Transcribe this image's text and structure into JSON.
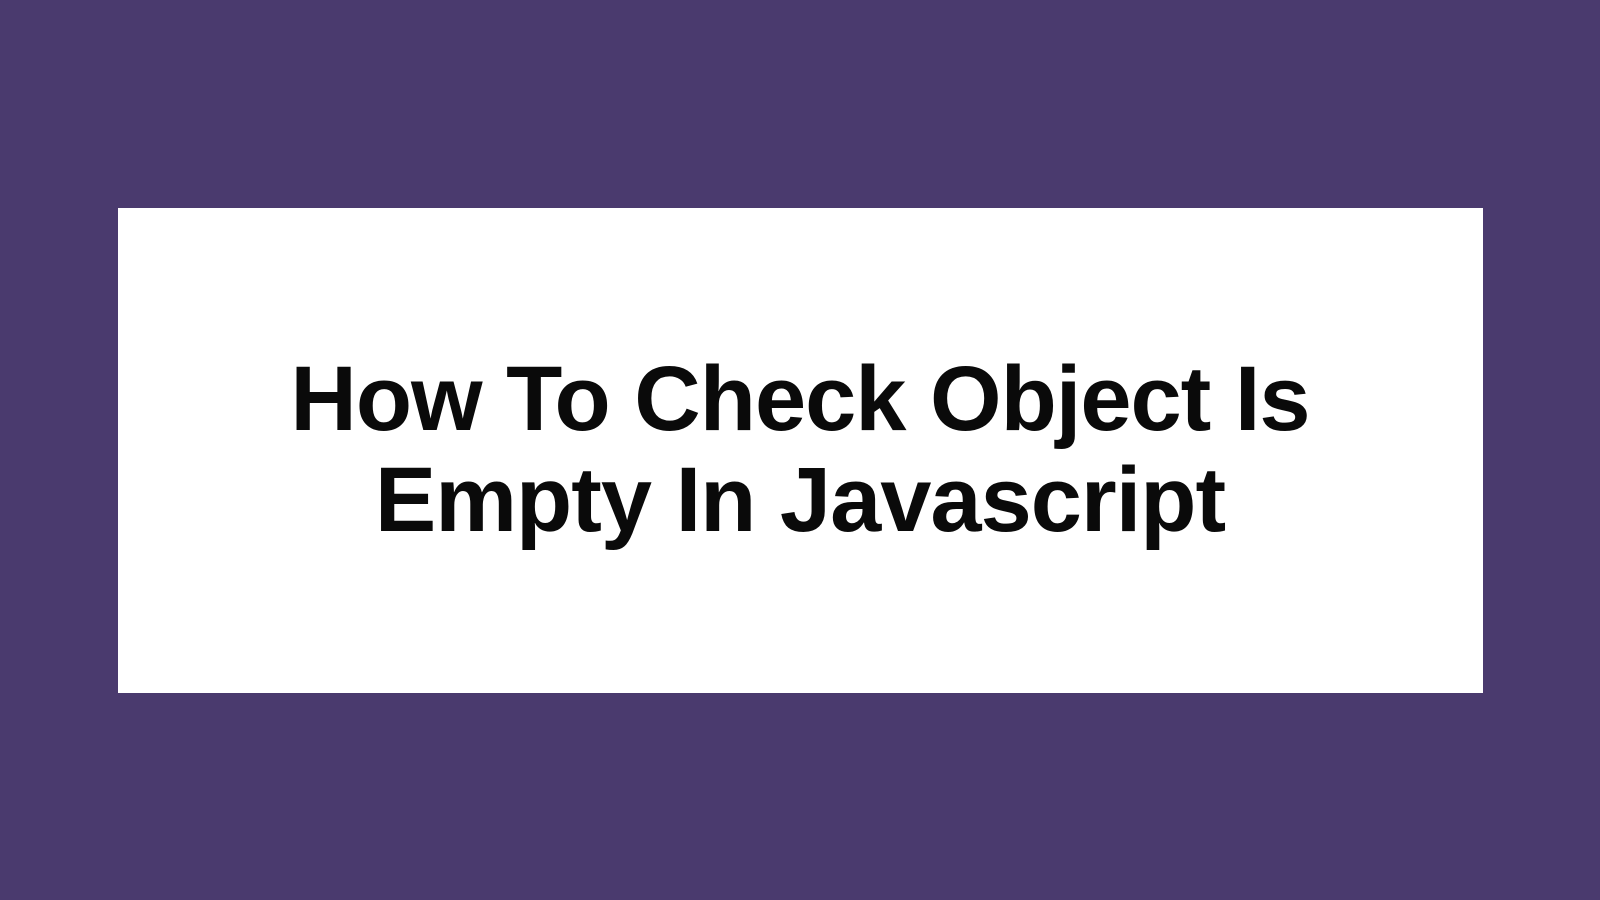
{
  "card": {
    "title": "How To Check Object Is Empty In Javascript"
  },
  "colors": {
    "background": "#4a3a6e",
    "card_background": "#ffffff",
    "text": "#0a0a0a"
  }
}
